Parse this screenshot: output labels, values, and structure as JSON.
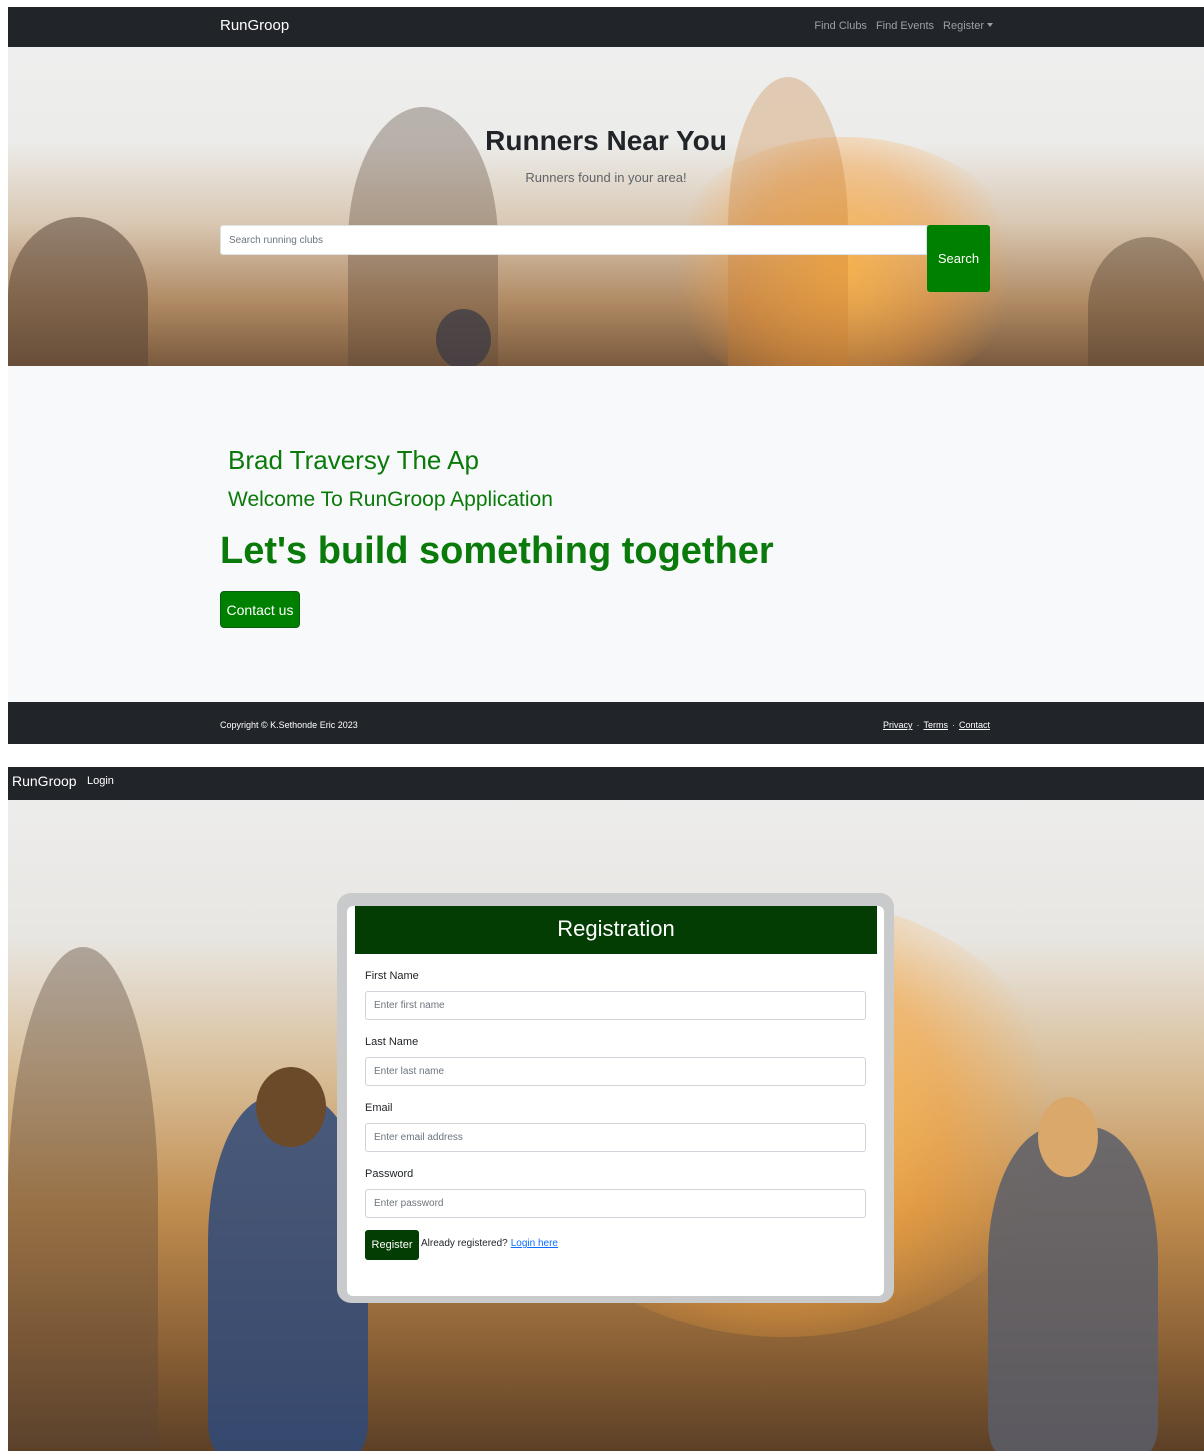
{
  "home": {
    "navbar": {
      "brand": "RunGroop",
      "links": [
        "Find Clubs",
        "Find Events",
        "Register"
      ]
    },
    "hero": {
      "title": "Runners Near You",
      "subtitle": "Runners found in your area!",
      "search_placeholder": "Search running clubs",
      "search_button": "Search"
    },
    "main": {
      "heading1": "Brad Traversy The Ap",
      "heading2": "Welcome To RunGroop Application",
      "heading3": "Let's build something together",
      "contact_button": "Contact us"
    },
    "footer": {
      "copyright": "Copyright © K.Sethonde Eric 2023",
      "links": [
        "Privacy",
        "Terms",
        "Contact"
      ],
      "separator": "·"
    }
  },
  "register": {
    "navbar": {
      "brand": "RunGroop",
      "login": "Login"
    },
    "form": {
      "title": "Registration",
      "first_name_label": "First Name",
      "first_name_placeholder": "Enter first name",
      "last_name_label": "Last Name",
      "last_name_placeholder": "Enter last name",
      "email_label": "Email",
      "email_placeholder": "Enter email address",
      "password_label": "Password",
      "password_placeholder": "Enter password",
      "register_button": "Register",
      "already_text": "Already registered?",
      "login_link": "Login here"
    }
  },
  "colors": {
    "navbar": "#212529",
    "accent_green": "#008000",
    "dark_green": "#033d03",
    "heading_green": "#0a7a0a",
    "link_blue": "#0d6efd"
  }
}
